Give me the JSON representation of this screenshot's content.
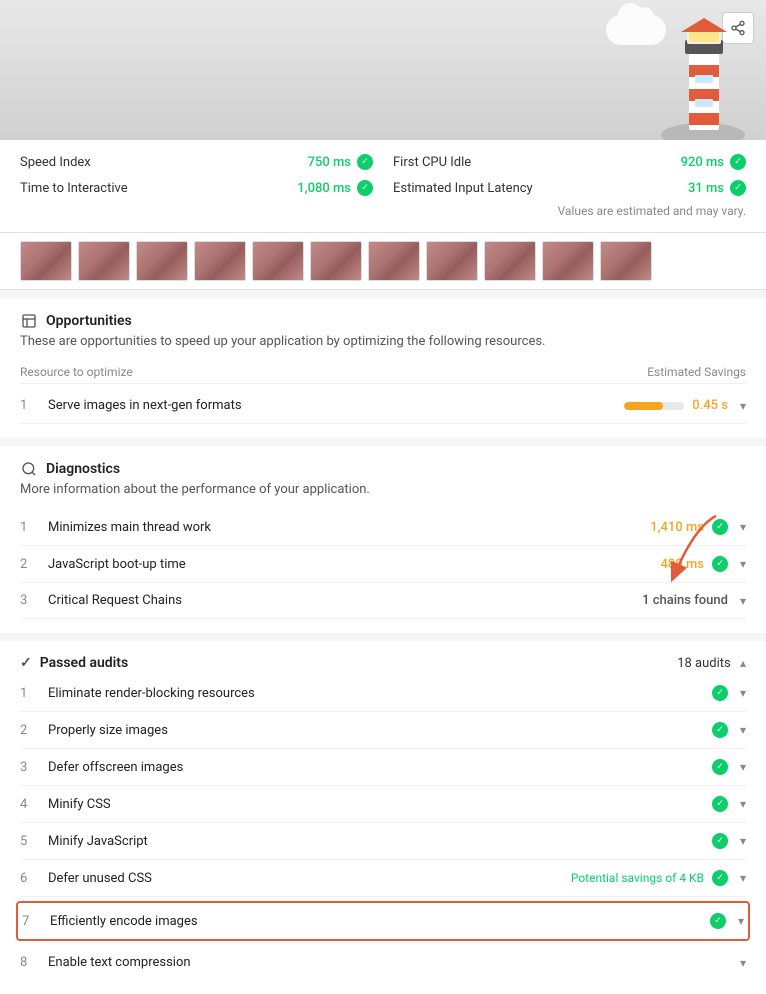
{
  "header": {
    "share_label": "share"
  },
  "metrics": {
    "note": "Values are estimated and may vary.",
    "items": [
      {
        "label": "Speed Index",
        "value": "750 ms",
        "passed": true
      },
      {
        "label": "First CPU Idle",
        "value": "920 ms",
        "passed": true
      },
      {
        "label": "Time to Interactive",
        "value": "1,080 ms",
        "passed": true
      },
      {
        "label": "Estimated Input Latency",
        "value": "31 ms",
        "passed": true
      }
    ]
  },
  "opportunities": {
    "title": "Opportunities",
    "description": "These are opportunities to speed up your application by optimizing the following resources.",
    "col_resource": "Resource to optimize",
    "col_savings": "Estimated Savings",
    "items": [
      {
        "num": "1",
        "label": "Serve images in next-gen formats",
        "savings": "0.45 s",
        "bar_pct": 65
      }
    ]
  },
  "diagnostics": {
    "title": "Diagnostics",
    "description": "More information about the performance of your application.",
    "items": [
      {
        "num": "1",
        "label": "Minimizes main thread work",
        "value": "1,410 ms",
        "type": "orange",
        "has_check": true
      },
      {
        "num": "2",
        "label": "JavaScript boot-up time",
        "value": "480 ms",
        "type": "orange",
        "has_check": true
      },
      {
        "num": "3",
        "label": "Critical Request Chains",
        "value": "1 chains found",
        "type": "neutral",
        "has_check": false
      }
    ]
  },
  "passed": {
    "title": "Passed audits",
    "count": "18 audits",
    "items": [
      {
        "num": "1",
        "label": "Eliminate render-blocking resources",
        "value": "",
        "has_check": true,
        "highlighted": false
      },
      {
        "num": "2",
        "label": "Properly size images",
        "value": "",
        "has_check": true,
        "highlighted": false
      },
      {
        "num": "3",
        "label": "Defer offscreen images",
        "value": "",
        "has_check": true,
        "highlighted": false
      },
      {
        "num": "4",
        "label": "Minify CSS",
        "value": "",
        "has_check": true,
        "highlighted": false
      },
      {
        "num": "5",
        "label": "Minify JavaScript",
        "value": "",
        "has_check": true,
        "highlighted": false
      },
      {
        "num": "6",
        "label": "Defer unused CSS",
        "value": "Potential savings of 4 KB",
        "has_check": true,
        "highlighted": false
      },
      {
        "num": "7",
        "label": "Efficiently encode images",
        "value": "",
        "has_check": true,
        "highlighted": true
      },
      {
        "num": "8",
        "label": "Enable text compression",
        "value": "",
        "has_check": false,
        "highlighted": false
      }
    ]
  }
}
